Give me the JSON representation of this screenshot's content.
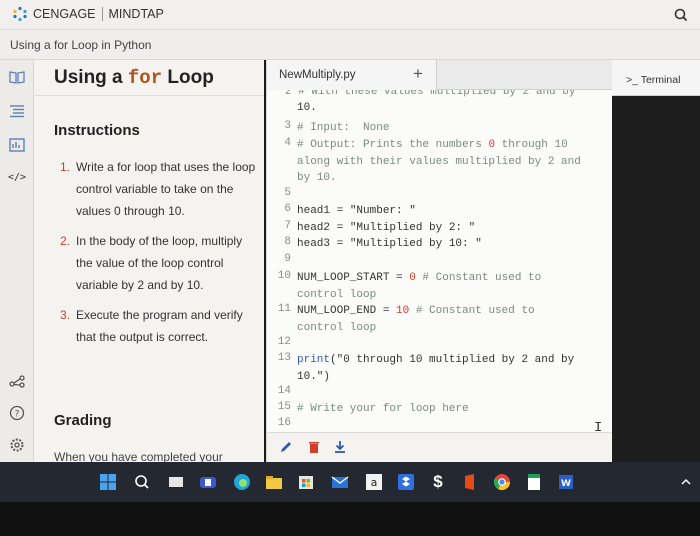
{
  "app": {
    "brand": "CENGAGE",
    "product": "MINDTAP"
  },
  "breadcrumb": "Using a for Loop in Python",
  "instructions": {
    "title_prefix": "Using a",
    "title_keyword": "for",
    "title_suffix": "Loop",
    "heading": "Instructions",
    "steps": [
      {
        "num": "1.",
        "text": "Write a for loop that uses the loop control variable to take on the values 0 through 10."
      },
      {
        "num": "2.",
        "text": "In the body of the loop, multiply the value of the loop control variable by 2 and by 10."
      },
      {
        "num": "3.",
        "text": "Execute the program and verify that the output is correct."
      }
    ],
    "grading": "Grading",
    "completed": "When you have completed your"
  },
  "editor": {
    "tab_label": "NewMultiply.py",
    "add_tab": "+"
  },
  "code": {
    "l_partial": "2 # With these values multiplied by 2 and by",
    "l_partial_cont": "10.",
    "l3": "# Input:  None",
    "l4a": "# Output: Prints the numbers",
    "l4b": " through 10",
    "l4c": "along with their values multiplied by 2 and",
    "l4d": "by 10.",
    "l6a": "head1 = ",
    "l6b": "\"Number: \"",
    "l7a": "head2 = ",
    "l7b": "\"Multiplied by 2: \"",
    "l8a": "head3 = ",
    "l8b": "\"Multiplied by 10: \"",
    "l10a": "NUM_LOOP_START = ",
    "l10b": "0",
    "l10c": " # Constant used to",
    "l10d": "control loop",
    "l11a": "NUM_LOOP_END = ",
    "l11b": "10",
    "l11c": " # Constant used to",
    "l11d": "control loop",
    "l13a": "print",
    "l13b": "(\"0 through 10 multiplied by 2 and by",
    "l13c": "10.\")",
    "l15": "# Write your for loop here",
    "zero": "0",
    "ln3": "3",
    "ln4": "4",
    "ln5": "5",
    "ln6": "6",
    "ln7": "7",
    "ln8": "8",
    "ln9": "9",
    "ln10": "10",
    "ln11": "11",
    "ln12": "12",
    "ln13": "13",
    "ln14": "14",
    "ln15": "15",
    "ln16": "16"
  },
  "terminal": {
    "label": "Terminal",
    "prompt_icon": ">_"
  },
  "colors": {
    "keyword_orange": "#b3531a",
    "number_red": "#d23c2a",
    "function_blue": "#2d59b1",
    "comment_gray": "#7c8a7d"
  }
}
